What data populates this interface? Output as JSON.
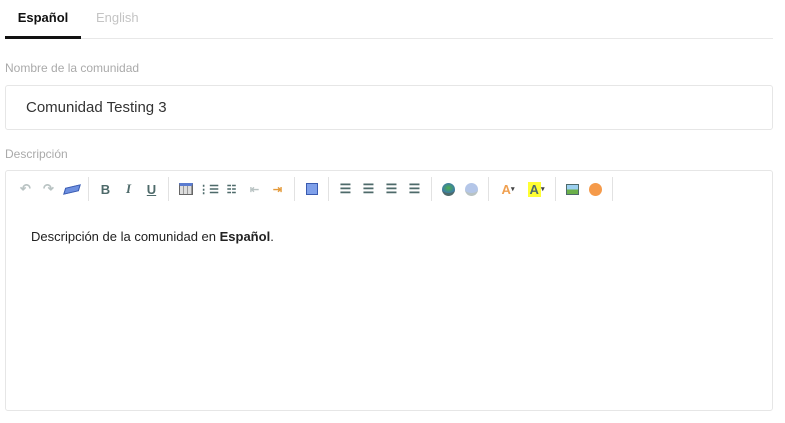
{
  "tabs": [
    {
      "label": "Español",
      "active": true
    },
    {
      "label": "English",
      "active": false
    }
  ],
  "name_field": {
    "label": "Nombre de la comunidad",
    "value": "Comunidad Testing 3"
  },
  "description": {
    "label": "Descripción",
    "toolbar": [
      "undo",
      "redo",
      "remove-format",
      "bold",
      "italic",
      "underline",
      "table",
      "ordered-list",
      "unordered-list",
      "outdent",
      "indent",
      "maximize",
      "align-left",
      "align-center",
      "align-right",
      "align-justify",
      "link",
      "unlink",
      "text-color",
      "background-color",
      "image",
      "emoticon"
    ],
    "toolbar_glyphs": {
      "bold": "B",
      "italic": "I",
      "underline": "U",
      "text_color": "A",
      "bg_color": "A"
    },
    "content_prefix": "Descripción de la comunidad en ",
    "content_bold": "Español",
    "content_suffix": "."
  },
  "colors": {
    "active_tab": "#111111",
    "inactive_tab": "#c4c4c4",
    "icon": "#4e6a6a",
    "highlight": "#ffff33"
  }
}
